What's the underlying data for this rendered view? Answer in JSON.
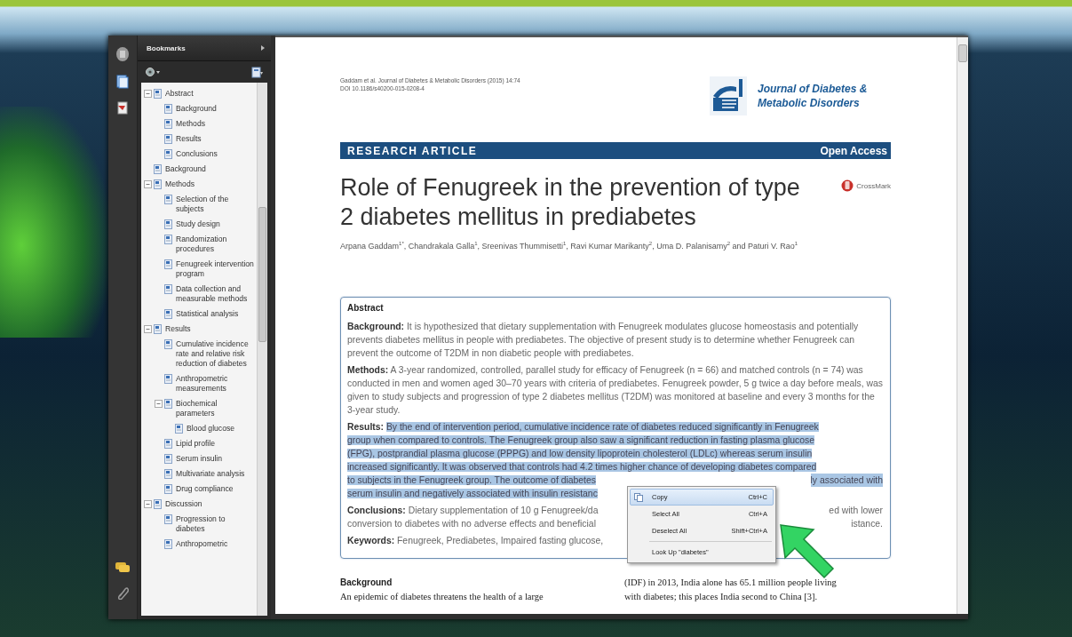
{
  "bookmarks": {
    "title": "Bookmarks",
    "items": [
      {
        "label": "Abstract",
        "expanded": true,
        "children": [
          {
            "label": "Background"
          },
          {
            "label": "Methods"
          },
          {
            "label": "Results"
          },
          {
            "label": "Conclusions"
          }
        ]
      },
      {
        "label": "Background"
      },
      {
        "label": "Methods",
        "expanded": true,
        "children": [
          {
            "label": "Selection of the subjects"
          },
          {
            "label": "Study design"
          },
          {
            "label": "Randomization procedures"
          },
          {
            "label": "Fenugreek intervention program"
          },
          {
            "label": "Data collection and measurable methods"
          },
          {
            "label": "Statistical analysis"
          }
        ]
      },
      {
        "label": "Results",
        "expanded": true,
        "children": [
          {
            "label": "Cumulative incidence rate and relative risk reduction of diabetes"
          },
          {
            "label": "Anthropometric measurements"
          },
          {
            "label": "Biochemical parameters",
            "expanded": true,
            "children": [
              {
                "label": "Blood glucose"
              }
            ]
          },
          {
            "label": "Lipid profile"
          },
          {
            "label": "Serum insulin"
          },
          {
            "label": "Multivariate analysis"
          },
          {
            "label": "Drug compliance"
          }
        ]
      },
      {
        "label": "Discussion",
        "expanded": true,
        "children": [
          {
            "label": "Progression to diabetes"
          },
          {
            "label": "Anthropometric"
          }
        ]
      }
    ]
  },
  "article": {
    "citation": "Gaddam et al. Journal of Diabetes & Metabolic Disorders (2015) 14:74",
    "doi": "DOI 10.1186/s40200-015-0208-4",
    "journal": "Journal of Diabetes & Metabolic Disorders",
    "article_type": "RESEARCH ARTICLE",
    "access": "Open Access",
    "crossmark": "CrossMark",
    "title": "Role of Fenugreek in the prevention of type 2 diabetes mellitus in prediabetes",
    "authors": "Arpana Gaddam$^{1*}$, Chandrakala Galla$^{1}$, Sreenivas Thummisetti$^{1}$, Ravi Kumar Marikanty$^{2}$, Uma D. Palanisamy$^{2}$ and Paturi V. Rao$^{1}$",
    "abstract": {
      "heading": "Abstract",
      "sections": [
        {
          "kind": "flow",
          "text": "**Background:** It is hypothesized that dietary supplementation with Fenugreek modulates glucose homeostasis and potentially prevents diabetes mellitus in people with prediabetes. The objective of present study is to determine whether Fenugreek can prevent the outcome of T2DM in non diabetic people with prediabetes."
        },
        {
          "kind": "flow",
          "text": "**Methods:** A 3-year randomized, controlled, parallel study for efficacy of Fenugreek (n = 66) and matched controls (n = 74) was conducted in men and women aged 30–70 years with criteria of prediabetes. Fenugreek powder, 5 g twice a day before meals, was given to study subjects and progression of type 2 diabetes mellitus (T2DM) was monitored at baseline and every 3 months for the 3-year study."
        },
        {
          "kind": "lines",
          "label": "Results:",
          "highlighted": true,
          "lines": [
            {
              "left": "By the end of intervention period, cumulative incidence rate of diabetes reduced significantly in Fenugreek"
            },
            {
              "left": "group when compared to controls. The Fenugreek group also saw a significant reduction in fasting plasma glucose"
            },
            {
              "left": "(FPG), postprandial plasma glucose (PPPG) and low density lipoprotein cholesterol (LDLc) whereas serum insulin"
            },
            {
              "left": "increased significantly. It was observed that controls had 4.2 times higher chance of developing diabetes compared"
            },
            {
              "left": "to subjects in the Fenugreek group. The outcome of diabetes",
              "right": "ly associated with"
            },
            {
              "left": "serum insulin and negatively associated with insulin resistanc"
            }
          ]
        },
        {
          "kind": "lines",
          "label": "Conclusions:",
          "highlighted": false,
          "lines": [
            {
              "left": "Dietary supplementation of 10 g Fenugreek/da",
              "right": "ed with lower"
            },
            {
              "left": "conversion to diabetes with no adverse effects and beneficial",
              "right": "istance."
            }
          ]
        },
        {
          "kind": "lines",
          "label": "Keywords:",
          "highlighted": false,
          "lines": [
            {
              "left": "Fenugreek, Prediabetes, Impaired fasting glucose,"
            }
          ]
        }
      ]
    },
    "body": {
      "heading": "Background",
      "left_lines": [
        "An epidemic of diabetes threatens the health of a large"
      ],
      "right_lines": [
        "(IDF) in 2013, India alone has 65.1 million people living",
        "with diabetes; this places India second to China [3]."
      ]
    }
  },
  "context_menu": [
    {
      "label": "Copy",
      "shortcut": "Ctrl+C",
      "selected": true,
      "divider_above": false
    },
    {
      "label": "Select All",
      "shortcut": "Ctrl+A",
      "selected": false,
      "divider_above": false
    },
    {
      "label": "Deselect All",
      "shortcut": "Shift+Ctrl+A",
      "selected": false,
      "divider_above": false
    },
    {
      "label": "Look Up \"diabetes\"",
      "selected": false,
      "divider_above": true
    }
  ]
}
